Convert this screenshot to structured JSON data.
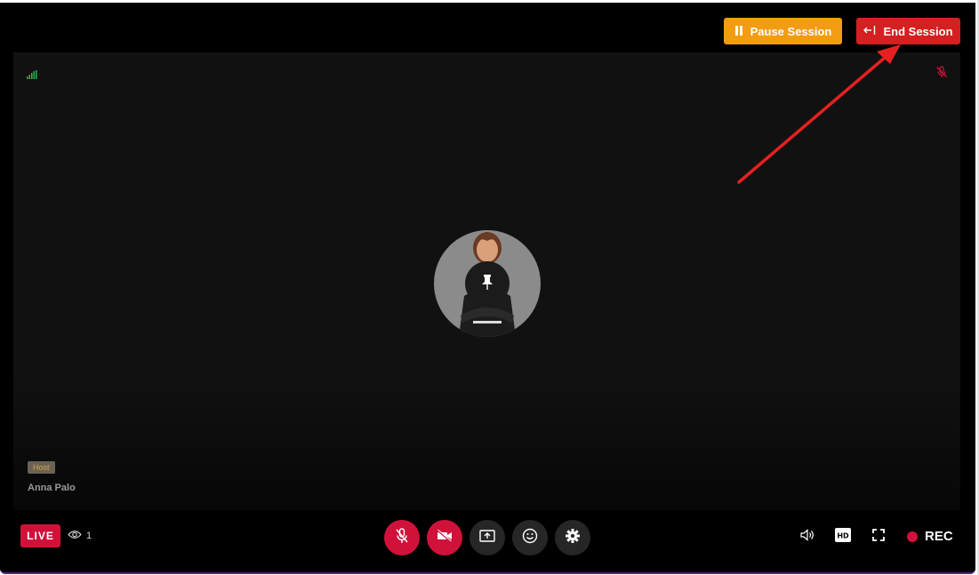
{
  "header": {
    "pause_label": "Pause Session",
    "end_label": "End Session"
  },
  "participant": {
    "role_badge": "Host",
    "name": "Anna Palo"
  },
  "footer": {
    "live_label": "LIVE",
    "viewer_count": "1",
    "rec_label": "REC"
  },
  "icons": {
    "signal": "signal-bars-icon",
    "mic_off": "mic-off-icon",
    "video_off": "video-off-icon",
    "share": "screen-share-icon",
    "emoji": "emoji-icon",
    "settings": "gear-icon",
    "volume": "volume-icon",
    "hd": "hd-icon",
    "fullscreen": "fullscreen-icon",
    "pin": "pin-icon",
    "eye": "eye-icon"
  },
  "colors": {
    "pause": "#f39c12",
    "end": "#d42020",
    "live": "#d0123a",
    "annotation_arrow": "#e62020"
  }
}
